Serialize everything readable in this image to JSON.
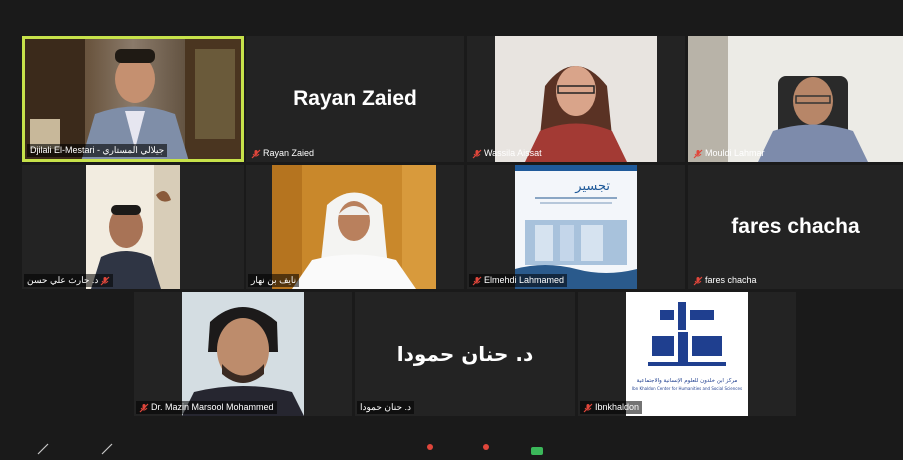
{
  "participants": [
    {
      "name": "Djilali El-Mestari - جيلالي المستاري",
      "muted": false,
      "active": true
    },
    {
      "name": "Rayan Zaied",
      "muted": true,
      "display_name": "Rayan Zaied"
    },
    {
      "name": "Wassila Aissat",
      "muted": true
    },
    {
      "name": "Mouldi Lahmar",
      "muted": true
    },
    {
      "name": "د. حارث علي حسن",
      "muted": true
    },
    {
      "name": "نايف بن نهار",
      "muted": false
    },
    {
      "name": "Elmehdi Lahmamed",
      "muted": true
    },
    {
      "name": "fares chacha",
      "muted": true,
      "display_name": "fares chacha"
    },
    {
      "name": "Dr. Mazin Marsool Mohammed",
      "muted": true
    },
    {
      "name": "د. حنان حمودا",
      "muted": false,
      "display_name": "د. حنان حمودا"
    },
    {
      "name": "Ibnkhaldon",
      "muted": true
    }
  ],
  "book_cover": {
    "title": "تجسير"
  },
  "logo": {
    "title": "ابن خلدون",
    "subtitle_ar": "مركز ابن خلدون للعلوم الإنسانية والاجتماعية",
    "subtitle_en": "Ibn Khaldon Center for Humanities and Social Sciences"
  },
  "colors": {
    "active_border": "#c7e24a",
    "muted_icon": "#e0463b",
    "tile_bg": "#232323"
  }
}
